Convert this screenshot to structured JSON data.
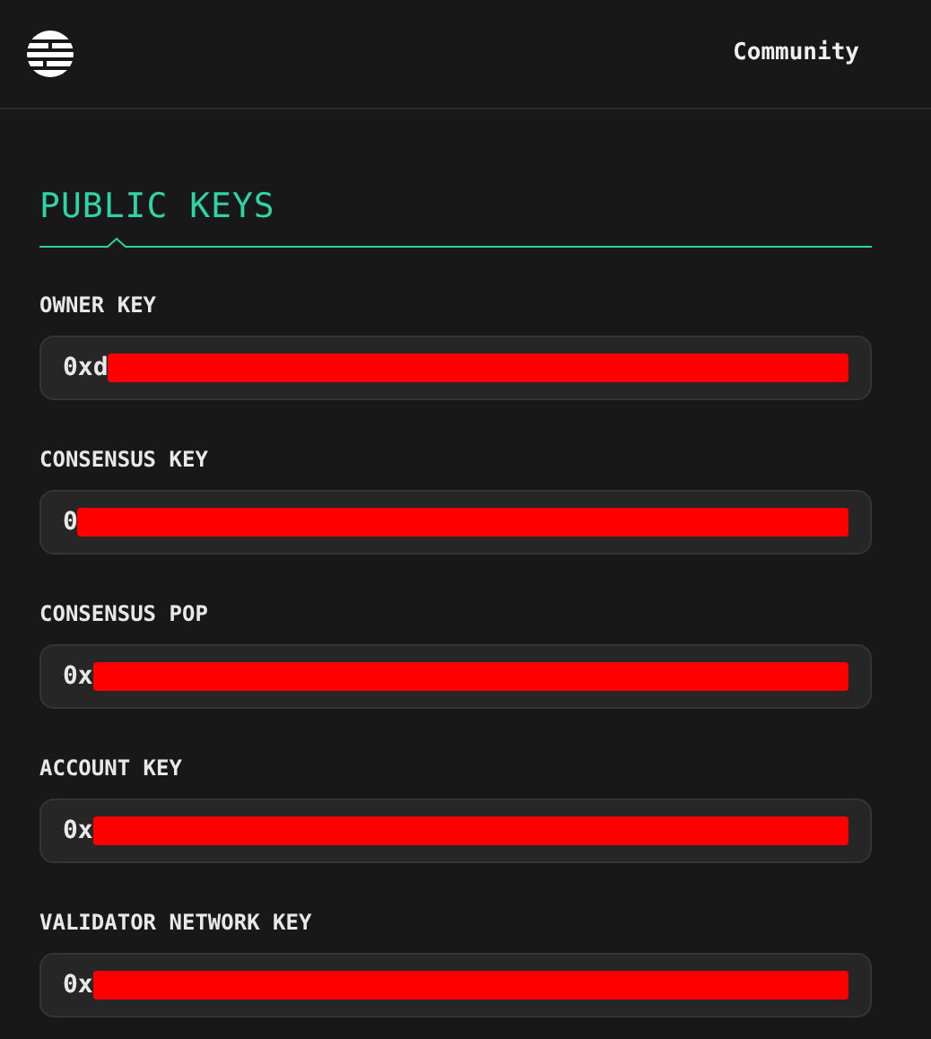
{
  "header": {
    "nav_link": "Community"
  },
  "section": {
    "title": "PUBLIC KEYS"
  },
  "keys": [
    {
      "label": "OWNER KEY",
      "value": "0xd"
    },
    {
      "label": "CONSENSUS KEY",
      "value": "0"
    },
    {
      "label": "CONSENSUS POP",
      "value": "0x"
    },
    {
      "label": "ACCOUNT KEY",
      "value": "0x"
    },
    {
      "label": "VALIDATOR NETWORK KEY",
      "value": "0x"
    }
  ]
}
